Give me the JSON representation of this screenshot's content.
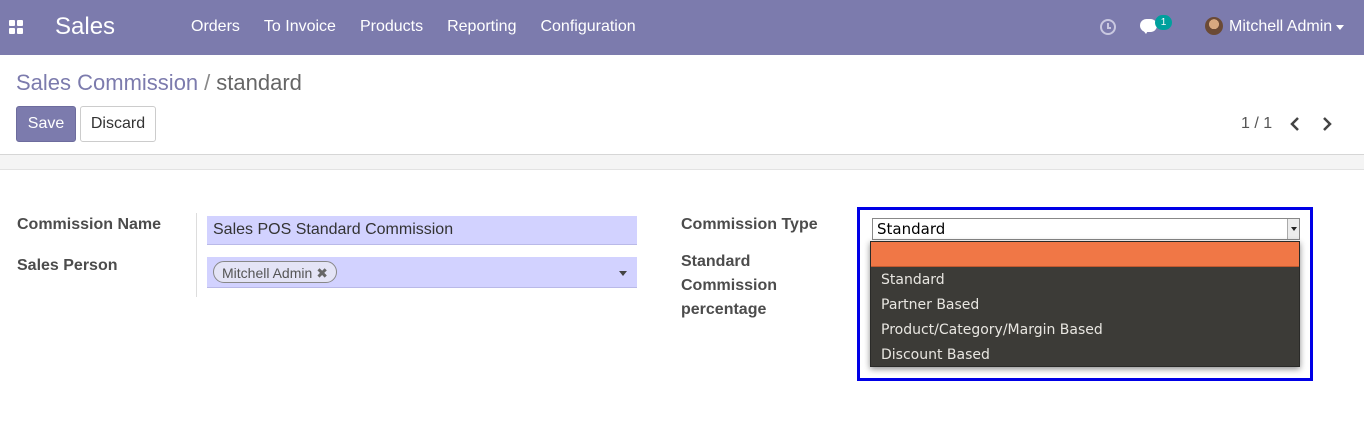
{
  "navbar": {
    "app_name": "Sales",
    "menu": [
      "Orders",
      "To Invoice",
      "Products",
      "Reporting",
      "Configuration"
    ],
    "chat_badge": "1",
    "user_name": "Mitchell Admin"
  },
  "breadcrumb": {
    "parent": "Sales Commission",
    "separator": "/",
    "current": "standard"
  },
  "buttons": {
    "save": "Save",
    "discard": "Discard"
  },
  "pager": {
    "value": "1 / 1"
  },
  "form": {
    "commission_name_label": "Commission Name",
    "commission_name_value": "Sales POS Standard Commission",
    "sales_person_label": "Sales Person",
    "sales_person_tag": "Mitchell Admin",
    "commission_type_label": "Commission Type",
    "commission_type_value": "Standard",
    "standard_pct_label_line1": "Standard",
    "standard_pct_label_line2": "Commission",
    "standard_pct_label_line3": "percentage",
    "options": [
      "",
      "Standard",
      "Partner Based",
      "Product/Category/Margin Based",
      "Discount Based"
    ]
  },
  "colors": {
    "navbar": "#7c7bad",
    "primary": "#7c7bad",
    "required_field": "#d2d2ff",
    "dropdown_bg": "#3c3b37",
    "option_highlight": "#f07746",
    "annotation_box": "#0000e6"
  }
}
